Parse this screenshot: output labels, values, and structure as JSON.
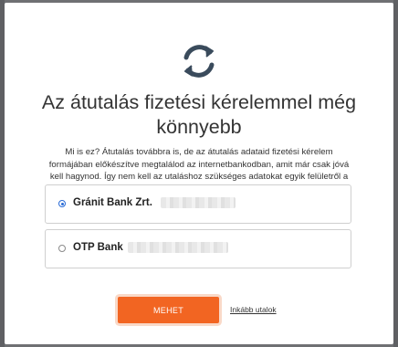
{
  "modal": {
    "title": "Az átutalás fizetési kérelemmel még könnyebb",
    "description": "Mi is ez? Átutalás továbbra is, de az átutalás adataid fizetési kérelem formájában előkészítve megtalálod az internetbankodban, amit már csak jóvá kell hagynod. Így nem kell az utaláshoz szükséges adatokat egyik felületről a másikra másolnod.",
    "icon": "refresh-icon",
    "options": [
      {
        "label": "Gránit Bank Zrt.",
        "selected": true
      },
      {
        "label": "OTP Bank",
        "selected": false
      }
    ],
    "primary_button": "MEHET",
    "secondary_link": "Inkább utalok"
  },
  "colors": {
    "accent": "#f26522",
    "icon": "#3a4b5c",
    "radio": "#2a6bd6"
  }
}
